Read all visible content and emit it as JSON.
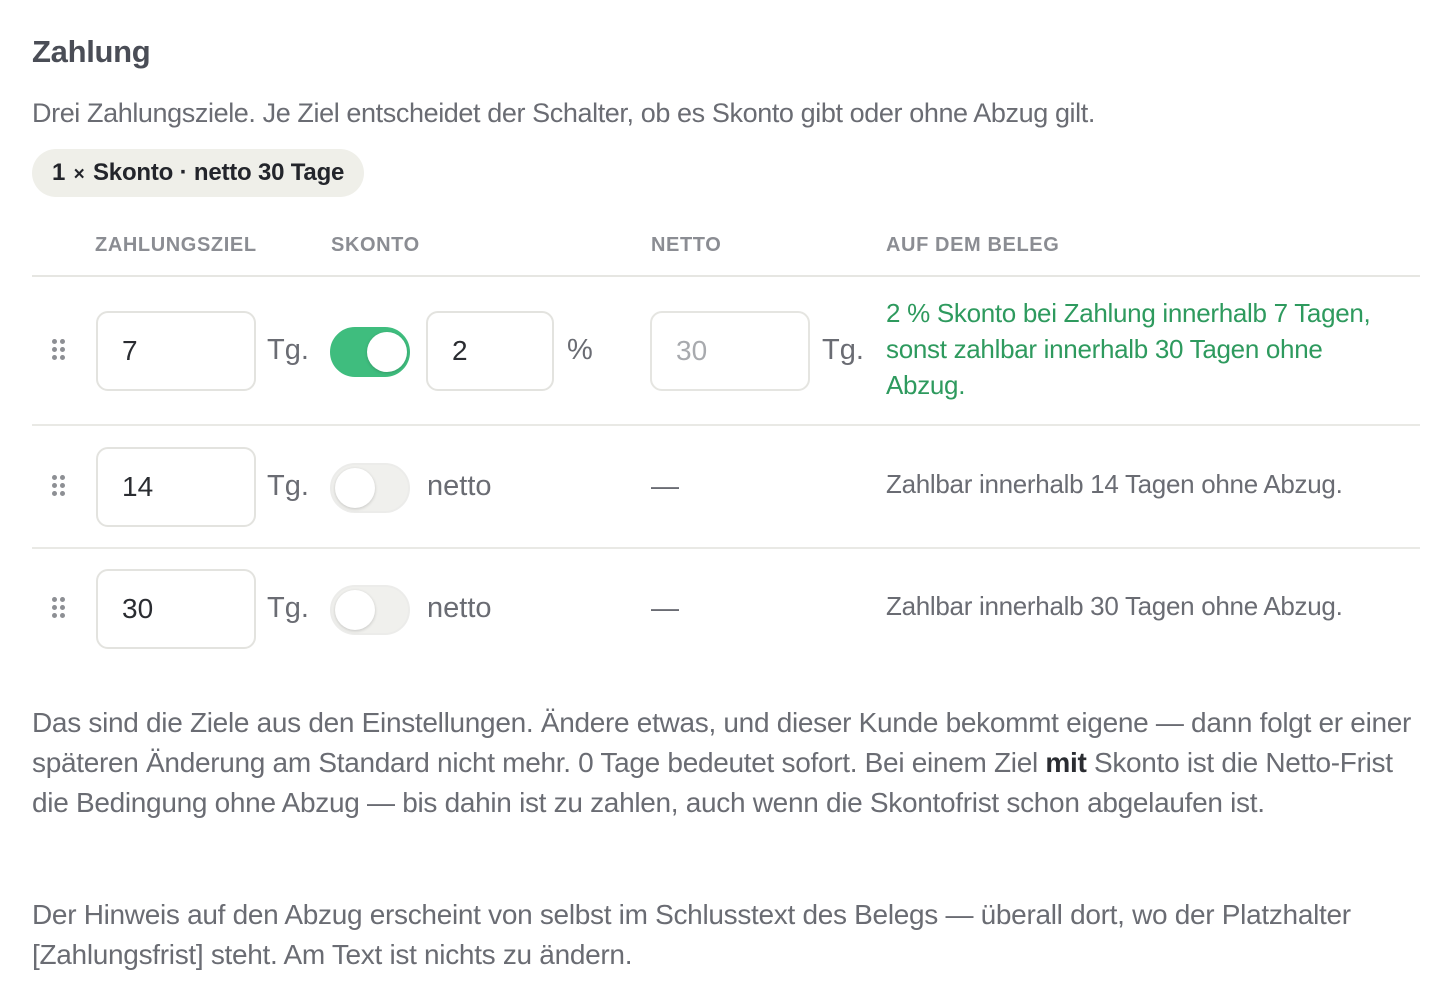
{
  "section": {
    "title": "Zahlung",
    "subtitle": "Drei Zahlungsziele. Je Ziel entscheidet der Schalter, ob es Skonto gibt oder ohne Abzug gilt.",
    "summary_count": "1",
    "summary_times": "×",
    "summary_text": "Skonto · netto 30 Tage"
  },
  "table": {
    "headers": {
      "zahlungsziel": "ZAHLUNGSZIEL",
      "skonto": "SKONTO",
      "netto": "NETTO",
      "beleg": "AUF DEM BELEG"
    },
    "day_unit": "Tg.",
    "percent_unit": "%",
    "netto_label": "netto",
    "empty_dash": "—",
    "rows": [
      {
        "days": "7",
        "skonto_enabled": true,
        "skonto_percent": "2",
        "netto_days": "30",
        "beleg_text": "2 % Skonto bei Zahlung innerhalb 7 Tagen, sonst zahlbar innerhalb 30 Tagen ohne Abzug."
      },
      {
        "days": "14",
        "skonto_enabled": false,
        "beleg_text": "Zahlbar innerhalb 14 Tagen ohne Abzug."
      },
      {
        "days": "30",
        "skonto_enabled": false,
        "beleg_text": "Zahlbar innerhalb 30 Tagen ohne Abzug."
      }
    ]
  },
  "notes": {
    "p1_before": "Das sind die Ziele aus den Einstellungen. Ändere etwas, und dieser Kunde bekommt eigene — dann folgt er einer späteren Änderung am Standard nicht mehr. 0 Tage bedeutet sofort. Bei einem Ziel ",
    "p1_bold": "mit",
    "p1_after": " Skonto ist die Netto-Frist die Bedingung ohne Abzug — bis dahin ist zu zahlen, auch wenn die Skontofrist schon abgelaufen ist.",
    "p2": "Der Hinweis auf den Abzug erscheint von selbst im Schlusstext des Belegs — überall dort, wo der Platzhalter [Zahlungsfrist] steht. Am Text ist nichts zu ändern."
  },
  "colors": {
    "accent_green": "#3fbd7e",
    "beleg_green": "#2e9a5e",
    "pill_bg": "#efefe9"
  }
}
